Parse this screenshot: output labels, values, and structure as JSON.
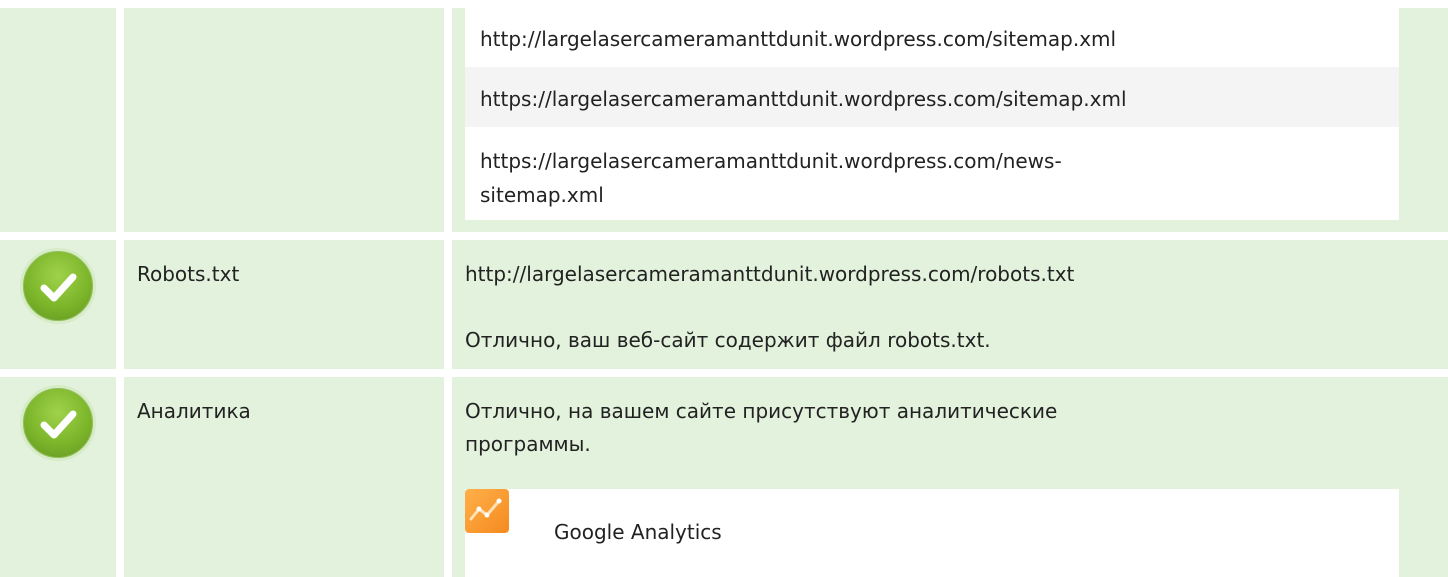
{
  "sitemaps": {
    "items": [
      "http://largelasercameramanttdunit.wordpress.com/sitemap.xml",
      "https://largelasercameramanttdunit.wordpress.com/sitemap.xml",
      "https://largelasercameramanttdunit.wordpress.com/news-",
      "sitemap.xml"
    ]
  },
  "robots": {
    "label": "Robots.txt",
    "url": "http://largelasercameramanttdunit.wordpress.com/robots.txt",
    "message": "Отлично, ваш веб-сайт содержит файл robots.txt.",
    "status_icon": "check-circle-icon"
  },
  "analytics": {
    "label": "Аналитика",
    "message_line1": "Отлично, на вашем сайте присутствуют аналитические",
    "message_line2": "программы.",
    "tool_name": "Google Analytics",
    "tool_icon": "google-analytics-icon",
    "status_icon": "check-circle-icon"
  },
  "colors": {
    "cell_bg": "#e2f2dc",
    "stripe_bg": "#f4f4f4",
    "check_green": "#7cb52a",
    "ga_orange": "#f58a1f"
  }
}
